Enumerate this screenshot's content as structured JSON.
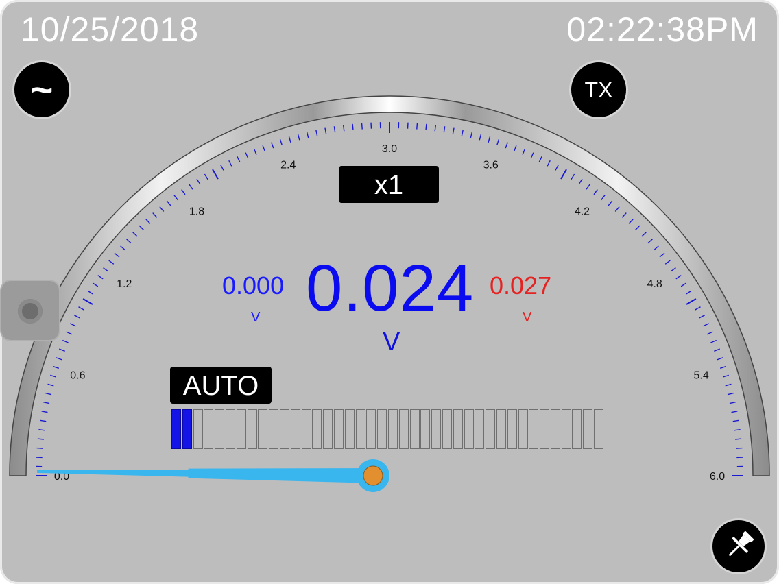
{
  "status_bar": {
    "date": "10/25/2018",
    "time": "02:22:38PM"
  },
  "buttons": {
    "ac_mode_symbol": "~",
    "tx_label": "TX",
    "range_label": "x1",
    "auto_label": "AUTO",
    "pin_icon": "pushpin-icon",
    "side_handle_icon": "circle-handle-icon"
  },
  "readings": {
    "min_value": "0.000",
    "min_unit": "V",
    "main_value": "0.024",
    "main_unit": "V",
    "max_value": "0.027",
    "max_unit": "V"
  },
  "gauge": {
    "scale_labels": [
      "0.0",
      "0.6",
      "1.2",
      "1.8",
      "2.4",
      "3.0",
      "3.6",
      "4.2",
      "4.8",
      "5.4",
      "6.0"
    ],
    "scale_min": 0,
    "scale_max": 6,
    "needle_value": 0.024
  },
  "bar_graph": {
    "total_segments": 40,
    "lit_segments": 2
  },
  "colors": {
    "background": "#bdbdbd",
    "main_reading": "#0b0bf0",
    "min_reading": "#1a1aff",
    "max_reading": "#e52222",
    "needle": "#3ab6ee",
    "needle_hub": "#e2902f",
    "tick": "#1a1ad0"
  }
}
